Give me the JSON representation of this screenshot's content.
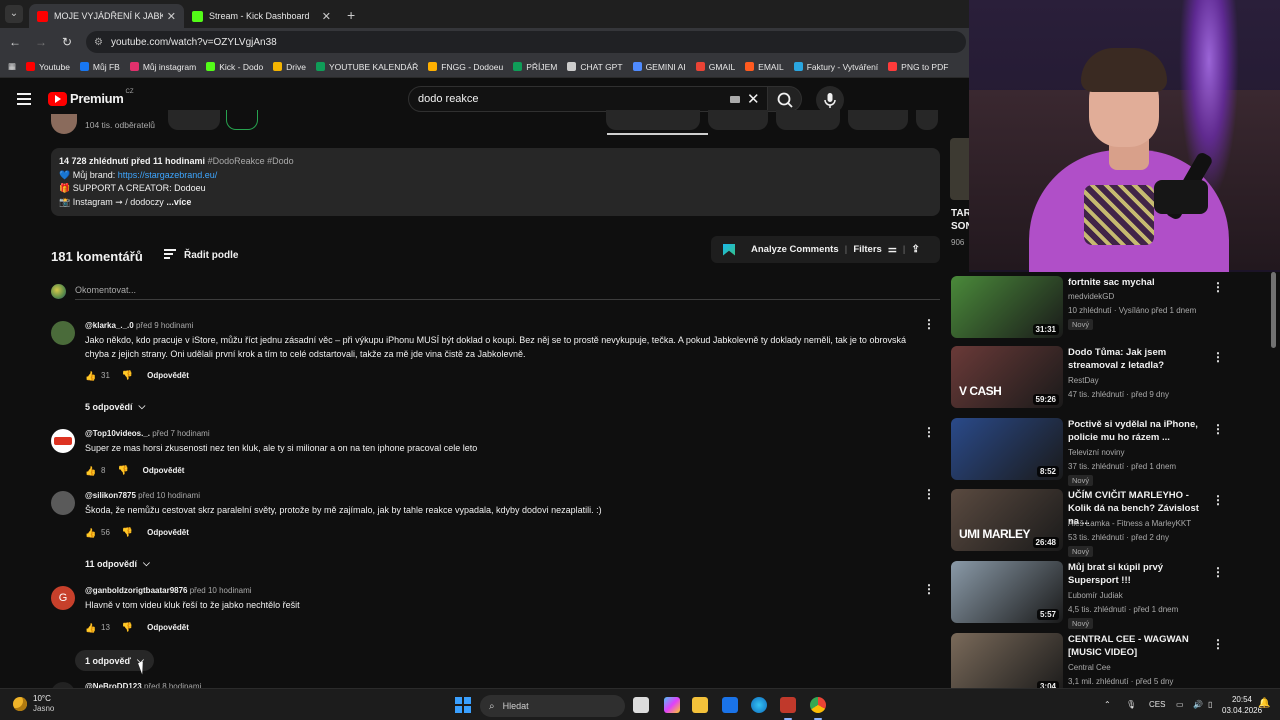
{
  "browser": {
    "tabs": [
      {
        "label": "MOJE VYJÁDŘENÍ K JABKOLEVNĚ",
        "active": true,
        "favicon_color": "#ff0000"
      },
      {
        "label": "Stream - Kick Dashboard",
        "active": false,
        "favicon_color": "#53fc18"
      }
    ],
    "new_tab": "+",
    "url": "youtube.com/watch?v=OZYLVgjAn38",
    "bookmarks": [
      {
        "label": "Youtube",
        "color": "#ff0000"
      },
      {
        "label": "Můj FB",
        "color": "#1877f2"
      },
      {
        "label": "Můj instagram",
        "color": "#e1306c"
      },
      {
        "label": "Kick - Dodo",
        "color": "#53fc18"
      },
      {
        "label": "Drive",
        "color": "#f4b400"
      },
      {
        "label": "YOUTUBE KALENDÁŘ",
        "color": "#0f9d58"
      },
      {
        "label": "FNGG - Dodoeu",
        "color": "#ffb000"
      },
      {
        "label": "PŘÍJEM",
        "color": "#0f9d58"
      },
      {
        "label": "CHAT GPT",
        "color": "#cccccc"
      },
      {
        "label": "GEMINI AI",
        "color": "#4f8bff"
      },
      {
        "label": "GMAIL",
        "color": "#ea4335"
      },
      {
        "label": "EMAIL",
        "color": "#ff5a1f"
      },
      {
        "label": "Faktury - Vytváření",
        "color": "#2aa6e0"
      },
      {
        "label": "PNG to PDF",
        "color": "#ff3b3b"
      }
    ]
  },
  "youtube": {
    "logo": "Premium",
    "logo_region": "CZ",
    "search_query": "dodo reakce",
    "subscribers": "104 tis. odběratelů",
    "description": {
      "views_line": "14 728 zhlédnutí  před 11 hodinami",
      "tags": "#DodoReakce #Dodo",
      "brand_prefix": "💙 Můj brand: ",
      "brand_link": "https://stargazebrand.eu/",
      "support": "🎁 SUPPORT A CREATOR: Dodoeu",
      "instagram_prefix": "📸 Instagram ➞ ",
      "instagram_handle": "/ dodoczy",
      "more": "...více"
    },
    "comments_count": "181 komentářů",
    "sort_label": "Řadit podle",
    "analyze_label": "Analyze Comments",
    "filters_label": "Filters",
    "add_comment_placeholder": "Okomentovat...",
    "comments": [
      {
        "author": "@klarka_._.0",
        "time": "před 9 hodinami",
        "text": "Jako někdo, kdo pracuje v iStore, můžu říct jednu zásadní věc – při výkupu iPhonu MUSÍ být doklad o koupi. Bez něj se to prostě nevykupuje, tečka. A pokud Jabkolevně ty doklady neměli, tak je to obrovská chyba z jejich strany. Oni udělali první krok a tím to celé odstartovali, takže za mě jde vina čistě za Jabkolevně.",
        "likes": "31",
        "reply": "Odpovědět",
        "replies": "5 odpovědí",
        "avatar_color": "#4a6b3a"
      },
      {
        "author": "@Top10videos._.",
        "time": "před 7 hodinami",
        "text": "Super ze mas horsi zkusenosti nez ten kluk, ale ty si milionar a on na ten iphone pracoval cele leto",
        "likes": "8",
        "reply": "Odpovědět",
        "replies": "",
        "avatar_color": "#ffffff"
      },
      {
        "author": "@silikon7875",
        "time": "před 10 hodinami",
        "text": "Škoda, že nemůžu cestovat skrz paralelní světy, protože by mě zajímalo, jak by tahle reakce vypadala, kdyby dodovi nezaplatili. :)",
        "likes": "56",
        "reply": "Odpovědět",
        "replies": "11 odpovědí",
        "avatar_color": "#5a5a5a"
      },
      {
        "author": "@ganboldzorigtbaatar9876",
        "time": "před 10 hodinami",
        "text": "Hlavně v tom videu kluk řeší to že jabko nechtělo řešit",
        "likes": "13",
        "reply": "Odpovědět",
        "replies": "1 odpověď",
        "avatar_color": "#c7402b",
        "avatar_letter": "G"
      },
      {
        "author": "@NeBroDD123",
        "time": "před 8 hodinami",
        "text": "",
        "likes": "",
        "reply": "",
        "replies": "",
        "avatar_color": "#222222"
      }
    ],
    "edge_card": {
      "title": "TAR SON",
      "views": "906"
    },
    "sidebar_videos": [
      {
        "title": "fortnite sac mychal",
        "channel": "medvidekGD",
        "stats": "10 zhlédnutí · Vysíláno před 1 dnem",
        "badge": "Nový",
        "duration": "31:31",
        "thumb_color": "#4a8a3a",
        "caption": ""
      },
      {
        "title": "Dodo Tůma: Jak jsem streamoval z letadla?",
        "channel": "RestDay",
        "stats": "47 tis. zhlédnutí · před 9 dny",
        "badge": "",
        "duration": "59:26",
        "thumb_color": "#6a3a38",
        "caption": "V CASH"
      },
      {
        "title": "Poctivě si vydělal na iPhone, policie mu ho rázem ...",
        "channel": "Televizní noviny",
        "stats": "37 tis. zhlédnutí · před 1 dnem",
        "badge": "Nový",
        "duration": "8:52",
        "thumb_color": "#2a4a8a",
        "caption": ""
      },
      {
        "title": "UČÍM CVIČIT MARLEYHO - Kolik dá na bench? Závislost na ...",
        "channel": "Aleš Lamka - Fitness a MarleyKKT",
        "stats": "53 tis. zhlédnutí · před 2 dny",
        "badge": "Nový",
        "duration": "26:48",
        "thumb_color": "#5a4a40",
        "caption": "UMI MARLEY"
      },
      {
        "title": "Můj brat si kúpil prvý Supersport !!!",
        "channel": "Ľubomír Judiak",
        "stats": "4,5 tis. zhlédnutí · před 1 dnem",
        "badge": "Nový",
        "duration": "5:57",
        "thumb_color": "#8a9aa8",
        "caption": ""
      },
      {
        "title": "CENTRAL CEE - WAGWAN [MUSIC VIDEO]",
        "channel": "Central Cee",
        "stats": "3,1 mil. zhlédnutí · před 5 dny",
        "badge": "",
        "duration": "3:04",
        "thumb_color": "#7a6a5a",
        "caption": ""
      }
    ]
  },
  "taskbar": {
    "temperature": "10°C",
    "weather": "Jasno",
    "search_placeholder": "Hledat",
    "language": "CES",
    "time": "20:54",
    "date": "03.04.2026"
  }
}
